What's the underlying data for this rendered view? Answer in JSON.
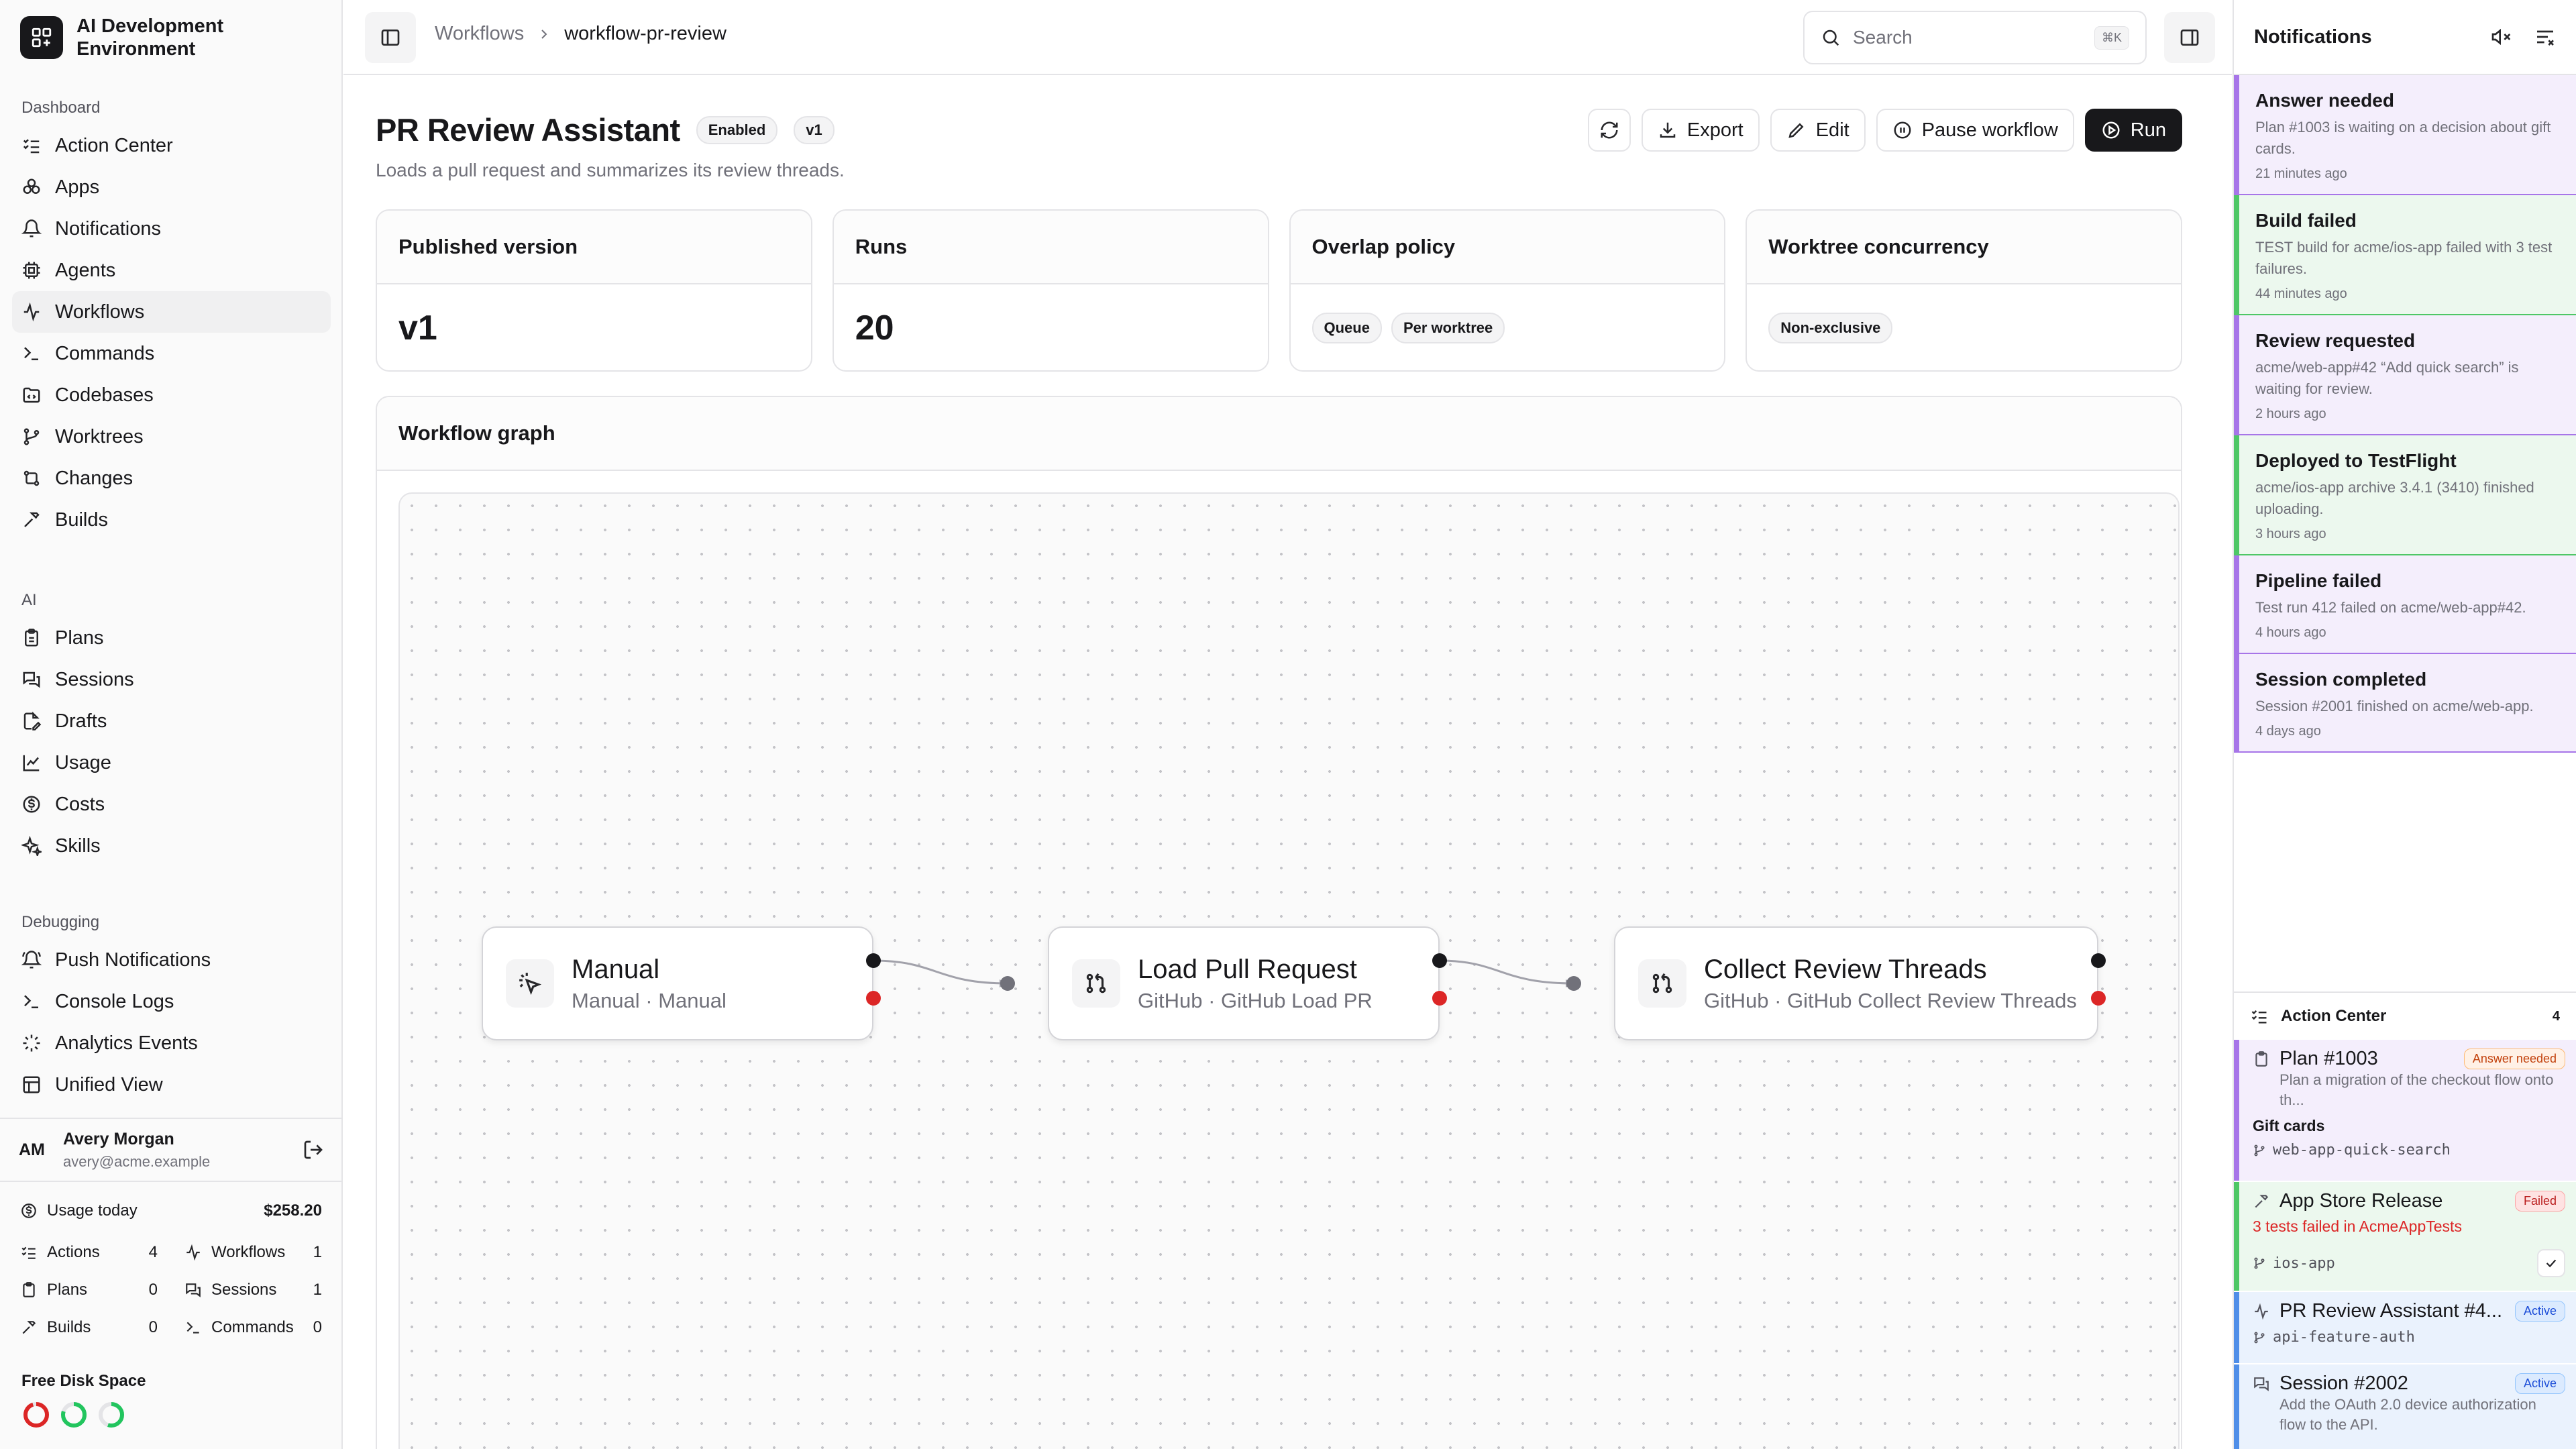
{
  "app": {
    "title": "AI Development Environment"
  },
  "sidebar": {
    "sections": [
      {
        "heading": "Dashboard",
        "items": [
          {
            "label": "Action Center",
            "icon": "list-checks-icon"
          },
          {
            "label": "Apps",
            "icon": "apps-icon"
          },
          {
            "label": "Notifications",
            "icon": "bell-icon"
          },
          {
            "label": "Agents",
            "icon": "cpu-icon"
          },
          {
            "label": "Workflows",
            "icon": "workflow-icon",
            "active": true
          },
          {
            "label": "Commands",
            "icon": "terminal-icon"
          },
          {
            "label": "Codebases",
            "icon": "folder-code-icon"
          },
          {
            "label": "Worktrees",
            "icon": "git-branch-icon"
          },
          {
            "label": "Changes",
            "icon": "git-compare-icon"
          },
          {
            "label": "Builds",
            "icon": "hammer-icon"
          }
        ]
      },
      {
        "heading": "AI",
        "items": [
          {
            "label": "Plans",
            "icon": "clipboard-icon"
          },
          {
            "label": "Sessions",
            "icon": "messages-icon"
          },
          {
            "label": "Drafts",
            "icon": "file-edit-icon"
          },
          {
            "label": "Usage",
            "icon": "chart-icon"
          },
          {
            "label": "Costs",
            "icon": "dollar-circle-icon"
          },
          {
            "label": "Skills",
            "icon": "sparkles-icon"
          }
        ]
      },
      {
        "heading": "Debugging",
        "items": [
          {
            "label": "Push Notifications",
            "icon": "bell-ring-icon"
          },
          {
            "label": "Console Logs",
            "icon": "terminal-icon"
          },
          {
            "label": "Analytics Events",
            "icon": "activity-icon"
          },
          {
            "label": "Unified View",
            "icon": "layout-icon"
          }
        ]
      }
    ],
    "user": {
      "initials": "AM",
      "name": "Avery Morgan",
      "email": "avery@acme.example"
    },
    "usage": {
      "label": "Usage today",
      "amount": "$258.20",
      "stats": [
        {
          "label": "Actions",
          "value": "4"
        },
        {
          "label": "Workflows",
          "value": "1"
        },
        {
          "label": "Plans",
          "value": "0"
        },
        {
          "label": "Sessions",
          "value": "1"
        },
        {
          "label": "Builds",
          "value": "0"
        },
        {
          "label": "Commands",
          "value": "0"
        }
      ]
    },
    "disk": {
      "label": "Free Disk Space",
      "rings": [
        {
          "color": "#dc2626",
          "fraction": 0.95
        },
        {
          "color": "#22c55e",
          "fraction": 0.8
        },
        {
          "color": "#22c55e",
          "fraction": 0.55
        }
      ]
    }
  },
  "topbar": {
    "breadcrumb": [
      "Workflows",
      "workflow-pr-review"
    ],
    "search": {
      "placeholder": "Search",
      "shortcut": "⌘K"
    }
  },
  "main": {
    "title": "PR Review Assistant",
    "badges": [
      "Enabled",
      "v1"
    ],
    "subtitle": "Loads a pull request and summarizes its review threads.",
    "actions": {
      "export": "Export",
      "edit": "Edit",
      "pause": "Pause workflow",
      "run": "Run"
    },
    "cards": {
      "published": {
        "label": "Published version",
        "value": "v1"
      },
      "runs": {
        "label": "Runs",
        "value": "20"
      },
      "overlap": {
        "label": "Overlap policy",
        "tags": [
          "Queue",
          "Per worktree"
        ]
      },
      "concurrency": {
        "label": "Worktree concurrency",
        "tags": [
          "Non-exclusive"
        ]
      }
    },
    "graph": {
      "label": "Workflow graph",
      "nodes": [
        {
          "title": "Manual",
          "subtitle": "Manual · Manual",
          "icon": "cursor-click-icon"
        },
        {
          "title": "Load Pull Request",
          "subtitle": "GitHub · GitHub Load PR",
          "icon": "git-pull-request-icon"
        },
        {
          "title": "Collect Review Threads",
          "subtitle": "GitHub · GitHub Collect Review Threads",
          "icon": "git-pull-request-icon"
        }
      ]
    }
  },
  "notifications": {
    "title": "Notifications",
    "items": [
      {
        "title": "Answer needed",
        "body": "Plan #1003 is waiting on a decision about gift cards.",
        "time": "21 minutes ago",
        "tone": "purple"
      },
      {
        "title": "Build failed",
        "body": "TEST build for acme/ios-app failed with 3 test failures.",
        "time": "44 minutes ago",
        "tone": "green"
      },
      {
        "title": "Review requested",
        "body": "acme/web-app#42 “Add quick search” is waiting for review.",
        "time": "2 hours ago",
        "tone": "purple"
      },
      {
        "title": "Deployed to TestFlight",
        "body": "acme/ios-app archive 3.4.1 (3410) finished uploading.",
        "time": "3 hours ago",
        "tone": "green"
      },
      {
        "title": "Pipeline failed",
        "body": "Test run 412 failed on acme/web-app#42.",
        "time": "4 hours ago",
        "tone": "purple"
      },
      {
        "title": "Session completed",
        "body": "Session #2001 finished on acme/web-app.",
        "time": "4 days ago",
        "tone": "purple"
      }
    ],
    "action_center": {
      "title": "Action Center",
      "count": "4",
      "items": [
        {
          "title": "Plan #1003",
          "badge": "Answer needed",
          "desc": "Plan a migration of the checkout flow onto th...",
          "extra": "Gift cards",
          "branch": "web-app-quick-search"
        },
        {
          "title": "App Store Release",
          "badge": "Failed",
          "error": "3 tests failed in AcmeAppTests",
          "branch": "ios-app"
        },
        {
          "title": "PR Review Assistant #4...",
          "badge": "Active",
          "branch": "api-feature-auth"
        },
        {
          "title": "Session #2002",
          "badge": "Active",
          "desc": "Add the OAuth 2.0 device authorization flow to the API."
        }
      ]
    }
  }
}
